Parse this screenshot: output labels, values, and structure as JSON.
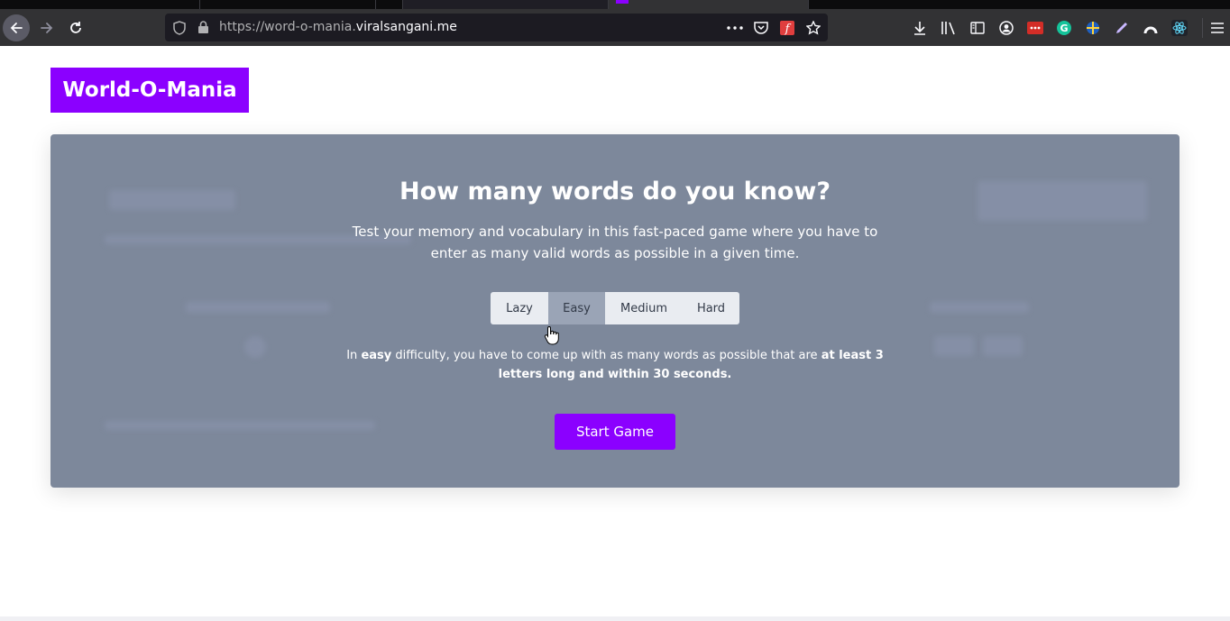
{
  "browser": {
    "url_prefix": "https://word-o-mania.",
    "url_domain": "viralsangani.me",
    "icons": [
      "back-icon",
      "forward-icon",
      "reload-icon",
      "shield-icon",
      "lock-icon",
      "more-icon",
      "pocket-icon",
      "extension-icon",
      "star-icon",
      "download-icon",
      "library-icon",
      "sidebar-icon",
      "account-icon",
      "lastpass-icon",
      "grammarly-icon",
      "flag-icon",
      "pen-icon",
      "profile-icon",
      "react-icon",
      "menu-icon"
    ]
  },
  "page": {
    "logo": "World-O-Mania",
    "headline": "How many words do you know?",
    "description": "Test your memory and vocabulary in this fast-paced game where you have to enter as many valid words as possible in a given time.",
    "difficulties": [
      "Lazy",
      "Easy",
      "Medium",
      "Hard"
    ],
    "selected_difficulty": "Easy",
    "rule": {
      "part1": "In ",
      "level": "easy",
      "part2": " difficulty, you have to come up with as many words as possible that are ",
      "emphasis": "at least 3 letters long and within 30 seconds."
    },
    "start_label": "Start Game"
  },
  "colors": {
    "brand": "#8b00ff",
    "card_overlay": "#7d889b",
    "selected_button": "#9aa4b6",
    "chrome": "#323234"
  }
}
